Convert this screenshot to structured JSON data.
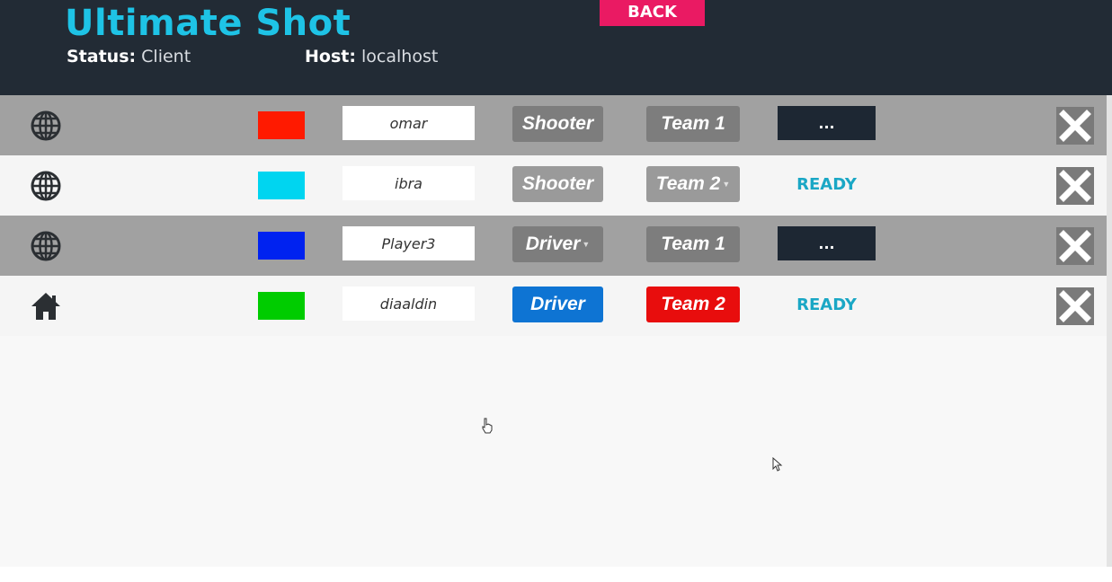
{
  "header": {
    "title": "Ultimate Shot",
    "status_label": "Status:",
    "status_value": "Client",
    "host_label": "Host:",
    "host_value": "localhost",
    "back_label": "BACK"
  },
  "colors": {
    "title": "#1ec3e6",
    "back": "#ea1a63",
    "ready": "#1aa7c5"
  },
  "players": [
    {
      "icon": "globe-icon",
      "color": "#ff1a00",
      "name": "omar",
      "role": "Shooter",
      "team": "Team 1",
      "state": "..."
    },
    {
      "icon": "globe-icon",
      "color": "#00d5f0",
      "name": "ibra",
      "role": "Shooter",
      "team": "Team 2",
      "state": "READY"
    },
    {
      "icon": "globe-icon",
      "color": "#0022f0",
      "name": "Player3",
      "role": "Driver",
      "team": "Team 1",
      "state": "..."
    },
    {
      "icon": "home-icon",
      "color": "#00cc00",
      "name": "diaaldin",
      "role": "Driver",
      "team": "Team 2",
      "state": "READY"
    }
  ]
}
